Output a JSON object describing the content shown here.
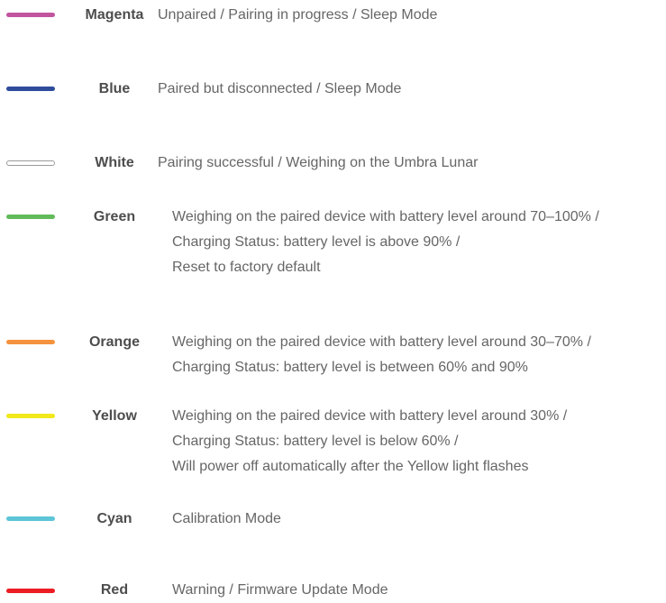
{
  "legend": [
    {
      "name": "Magenta",
      "color": "#c2549e",
      "lines": [
        "Unpaired / Pairing in progress / Sleep Mode"
      ]
    },
    {
      "name": "Blue",
      "color": "#2f4c9c",
      "lines": [
        "Paired but disconnected / Sleep Mode"
      ]
    },
    {
      "name": "White",
      "color": "#ffffff",
      "lines": [
        "Pairing successful / Weighing on the Umbra Lunar"
      ]
    },
    {
      "name": "Green",
      "color": "#62bb5a",
      "lines": [
        "Weighing on the paired device with battery level around 70–100% /",
        "Charging Status: battery level is above 90% /",
        "Reset to factory default"
      ]
    },
    {
      "name": "Orange",
      "color": "#f5923e",
      "lines": [
        "Weighing on the paired device with battery level around 30–70% /",
        "Charging Status: battery level is between 60% and 90%"
      ]
    },
    {
      "name": "Yellow",
      "color": "#f2e81a",
      "lines": [
        "Weighing on the paired device with battery level around 30% /",
        "Charging Status: battery level is below 60% /",
        "Will power off automatically after the Yellow light flashes"
      ]
    },
    {
      "name": "Cyan",
      "color": "#5cc5d7",
      "lines": [
        "Calibration Mode"
      ]
    },
    {
      "name": "Red",
      "color": "#ec1c24",
      "lines": [
        "Warning / Firmware Update Mode"
      ]
    }
  ]
}
